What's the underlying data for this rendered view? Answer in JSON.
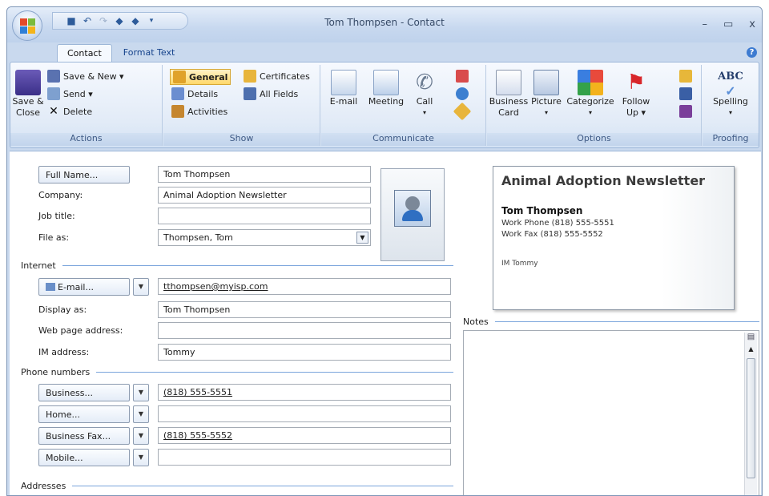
{
  "window": {
    "title": "Tom Thompsen - Contact",
    "controls": {
      "minimize": "–",
      "maximize": "▭",
      "close": "x"
    }
  },
  "qat": {
    "icons": [
      "save-icon",
      "undo-icon",
      "redo-icon",
      "previous-icon",
      "next-icon",
      "customize-icon"
    ]
  },
  "tabs": [
    {
      "label": "Contact",
      "active": true
    },
    {
      "label": "Format Text",
      "active": false
    }
  ],
  "ribbon": {
    "actions": {
      "label": "Actions",
      "save_close": "Save & Close",
      "save_close_line1": "Save &",
      "save_close_line2": "Close",
      "save_new": "Save & New ▾",
      "send": "Send ▾",
      "delete": "Delete"
    },
    "show": {
      "label": "Show",
      "general": "General",
      "certificates": "Certificates",
      "details": "Details",
      "all_fields": "All Fields",
      "activities": "Activities"
    },
    "communicate": {
      "label": "Communicate",
      "email": "E-mail",
      "meeting": "Meeting",
      "call": "Call"
    },
    "options": {
      "label": "Options",
      "business_card_line1": "Business",
      "business_card_line2": "Card",
      "picture": "Picture",
      "categorize": "Categorize",
      "follow_up_line1": "Follow",
      "follow_up_line2": "Up ▾"
    },
    "proofing": {
      "label": "Proofing",
      "spelling": "Spelling",
      "abc": "ABC"
    }
  },
  "form": {
    "full_name_button": "Full Name...",
    "full_name": "Tom Thompsen",
    "company_label": "Company:",
    "company": "Animal Adoption Newsletter",
    "job_title_label": "Job title:",
    "job_title": "",
    "file_as_label": "File as:",
    "file_as": "Thompsen, Tom",
    "internet_section": "Internet",
    "email_button": "E-mail...",
    "email": "tthompsen@myisp.com",
    "display_as_label": "Display as:",
    "display_as": "Tom Thompsen",
    "web_label": "Web page address:",
    "web": "",
    "im_label": "IM address:",
    "im": "Tommy",
    "phone_section": "Phone numbers",
    "business_button": "Business...",
    "business_phone": "(818) 555-5551",
    "home_button": "Home...",
    "home_phone": "",
    "fax_button": "Business Fax...",
    "fax": "(818) 555-5552",
    "mobile_button": "Mobile...",
    "mobile": "",
    "addresses_section": "Addresses"
  },
  "card": {
    "company": "Animal Adoption Newsletter",
    "name": "Tom Thompsen",
    "work_phone_label": "Work Phone",
    "work_phone": "(818) 555-5551",
    "work_fax_label": "Work Fax",
    "work_fax": "(818) 555-5552",
    "im": "IM Tommy"
  },
  "notes": {
    "label": "Notes"
  },
  "colors": {
    "ribbon_blue": "#c9d9ee",
    "accent_line": "#7aa5dc",
    "highlight": "#ffd86a"
  }
}
